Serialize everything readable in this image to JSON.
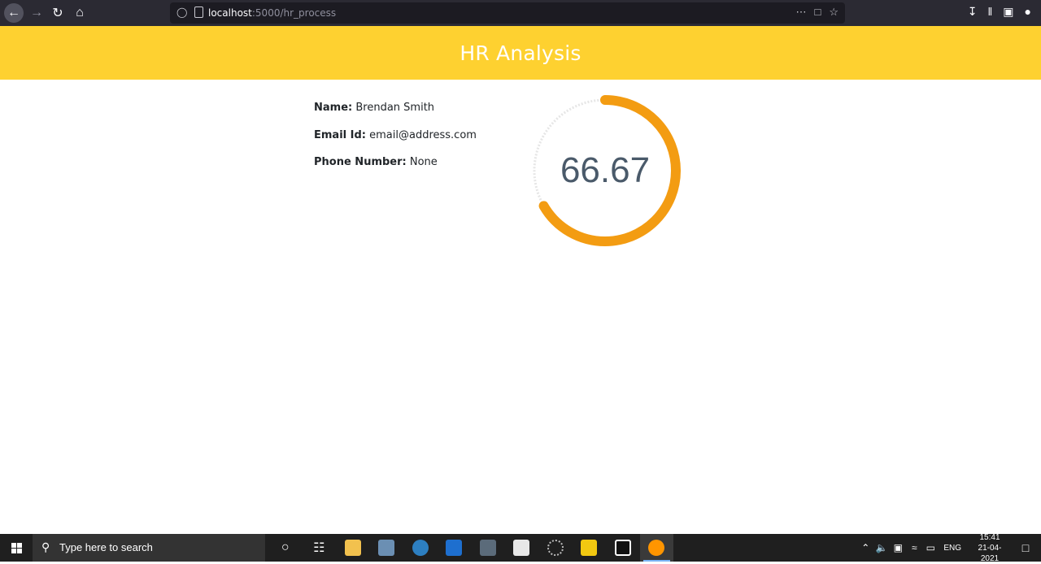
{
  "browser": {
    "url_host": "localhost",
    "url_path": ":5000/hr_process",
    "icons": [
      "back-icon",
      "forward-icon",
      "reload-icon",
      "home-icon",
      "shield-icon",
      "page-icon",
      "more-icon",
      "pocket-icon",
      "bookmark-star-icon",
      "download-icon",
      "library-icon",
      "sidebar-icon",
      "account-icon"
    ]
  },
  "header": {
    "title": "HR Analysis",
    "background_color": "#fed130"
  },
  "candidate": {
    "name_label": "Name:",
    "name_value": "Brendan Smith",
    "email_label": "Email Id:",
    "email_value": "email@address.com",
    "phone_label": "Phone Number:",
    "phone_value": "None"
  },
  "gauge": {
    "value_text": "66.67",
    "fraction": 0.6667,
    "track_color": "#e6e6e6",
    "fill_color": "#f39c12",
    "text_color": "#4a5a6a"
  },
  "taskbar": {
    "search_placeholder": "Type here to search",
    "apps": [
      "cortana-icon",
      "task-view-icon",
      "file-explorer-icon",
      "mail-icon",
      "edge-icon",
      "teamviewer-icon",
      "app-icon",
      "snowflake-app-icon",
      "loading-app-icon",
      "power-bi-icon",
      "pycharm-icon",
      "firefox-icon"
    ],
    "language": "ENG",
    "time": "15:41",
    "date": "21-04-2021"
  }
}
